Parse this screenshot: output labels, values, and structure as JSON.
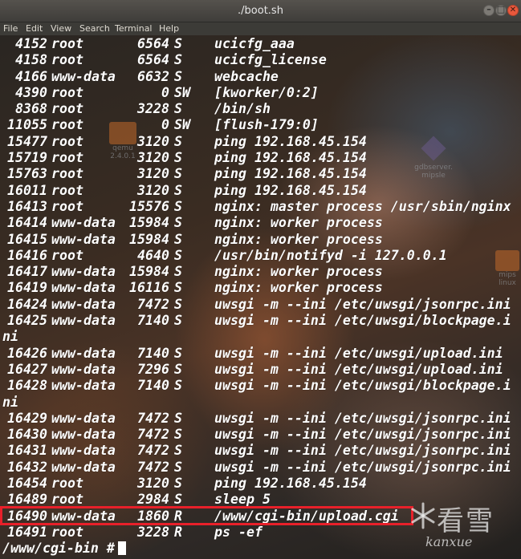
{
  "window": {
    "title": "./boot.sh",
    "menu": [
      "File",
      "Edit",
      "View",
      "Search",
      "Terminal",
      "Help"
    ]
  },
  "colors": {
    "text": "#ffffff",
    "highlight": "#e8202a",
    "titlebar": "#45433f",
    "close_button": "#e9583c"
  },
  "processes": [
    {
      "pid": "4152",
      "user": "root",
      "vsz": "6564",
      "stat": "S",
      "cmd": "ucicfg_aaa"
    },
    {
      "pid": "4158",
      "user": "root",
      "vsz": "6564",
      "stat": "S",
      "cmd": "ucicfg_license"
    },
    {
      "pid": "4166",
      "user": "www-data",
      "vsz": "6632",
      "stat": "S",
      "cmd": "webcache"
    },
    {
      "pid": "4390",
      "user": "root",
      "vsz": "0",
      "stat": "SW",
      "cmd": "[kworker/0:2]"
    },
    {
      "pid": "8368",
      "user": "root",
      "vsz": "3228",
      "stat": "S",
      "cmd": "/bin/sh"
    },
    {
      "pid": "11055",
      "user": "root",
      "vsz": "0",
      "stat": "SW",
      "cmd": "[flush-179:0]"
    },
    {
      "pid": "15477",
      "user": "root",
      "vsz": "3120",
      "stat": "S",
      "cmd": "ping 192.168.45.154"
    },
    {
      "pid": "15719",
      "user": "root",
      "vsz": "3120",
      "stat": "S",
      "cmd": "ping 192.168.45.154"
    },
    {
      "pid": "15763",
      "user": "root",
      "vsz": "3120",
      "stat": "S",
      "cmd": "ping 192.168.45.154"
    },
    {
      "pid": "16011",
      "user": "root",
      "vsz": "3120",
      "stat": "S",
      "cmd": "ping 192.168.45.154"
    },
    {
      "pid": "16413",
      "user": "root",
      "vsz": "15576",
      "stat": "S",
      "cmd": "nginx: master process /usr/sbin/nginx"
    },
    {
      "pid": "16414",
      "user": "www-data",
      "vsz": "15984",
      "stat": "S",
      "cmd": "nginx: worker process"
    },
    {
      "pid": "16415",
      "user": "www-data",
      "vsz": "15984",
      "stat": "S",
      "cmd": "nginx: worker process"
    },
    {
      "pid": "16416",
      "user": "root",
      "vsz": "4640",
      "stat": "S",
      "cmd": "/usr/bin/notifyd -i 127.0.0.1"
    },
    {
      "pid": "16417",
      "user": "www-data",
      "vsz": "15984",
      "stat": "S",
      "cmd": "nginx: worker process"
    },
    {
      "pid": "16419",
      "user": "www-data",
      "vsz": "16116",
      "stat": "S",
      "cmd": "nginx: worker process"
    },
    {
      "pid": "16424",
      "user": "www-data",
      "vsz": "7472",
      "stat": "S",
      "cmd": "uwsgi -m --ini /etc/uwsgi/jsonrpc.ini"
    },
    {
      "pid": "16425",
      "user": "www-data",
      "vsz": "7140",
      "stat": "S",
      "cmd": "uwsgi -m --ini /etc/uwsgi/blockpage.i",
      "wrap": "ni"
    },
    {
      "pid": "16426",
      "user": "www-data",
      "vsz": "7140",
      "stat": "S",
      "cmd": "uwsgi -m --ini /etc/uwsgi/upload.ini"
    },
    {
      "pid": "16427",
      "user": "www-data",
      "vsz": "7296",
      "stat": "S",
      "cmd": "uwsgi -m --ini /etc/uwsgi/upload.ini"
    },
    {
      "pid": "16428",
      "user": "www-data",
      "vsz": "7140",
      "stat": "S",
      "cmd": "uwsgi -m --ini /etc/uwsgi/blockpage.i",
      "wrap": "ni"
    },
    {
      "pid": "16429",
      "user": "www-data",
      "vsz": "7472",
      "stat": "S",
      "cmd": "uwsgi -m --ini /etc/uwsgi/jsonrpc.ini"
    },
    {
      "pid": "16430",
      "user": "www-data",
      "vsz": "7472",
      "stat": "S",
      "cmd": "uwsgi -m --ini /etc/uwsgi/jsonrpc.ini"
    },
    {
      "pid": "16431",
      "user": "www-data",
      "vsz": "7472",
      "stat": "S",
      "cmd": "uwsgi -m --ini /etc/uwsgi/jsonrpc.ini"
    },
    {
      "pid": "16432",
      "user": "www-data",
      "vsz": "7472",
      "stat": "S",
      "cmd": "uwsgi -m --ini /etc/uwsgi/jsonrpc.ini"
    },
    {
      "pid": "16454",
      "user": "root",
      "vsz": "3120",
      "stat": "S",
      "cmd": "ping 192.168.45.154"
    },
    {
      "pid": "16489",
      "user": "root",
      "vsz": "2984",
      "stat": "S",
      "cmd": "sleep 5"
    },
    {
      "pid": "16490",
      "user": "www-data",
      "vsz": "1860",
      "stat": "R",
      "cmd": "/www/cgi-bin/upload.cgi",
      "highlighted": true
    },
    {
      "pid": "16491",
      "user": "root",
      "vsz": "3228",
      "stat": "R",
      "cmd": "ps -ef"
    }
  ],
  "prompt": "/www/cgi-bin #",
  "desktop_icons": [
    {
      "label": "qemu",
      "sub": "2.4.0.1"
    },
    {
      "label": "gdbserver.",
      "sub": "mipsle"
    },
    {
      "label": "mips",
      "sub": "linux"
    }
  ],
  "watermark": {
    "text": "看雪",
    "script": "kanxue"
  }
}
